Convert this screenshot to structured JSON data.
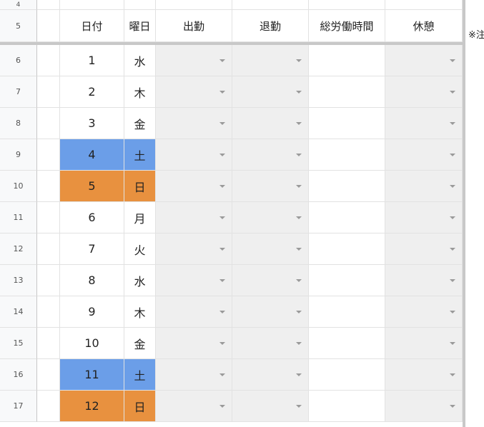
{
  "sheet": {
    "header_row_number": "5",
    "top_row_number": "4",
    "columns": {
      "date": "日付",
      "weekday": "曜日",
      "clock_in": "出勤",
      "clock_out": "退勤",
      "total_hours": "総労働時間",
      "break": "休憩"
    },
    "note_fragment": "※注",
    "rows": [
      {
        "row_number": "6",
        "date": "1",
        "weekday": "水",
        "highlight": "none"
      },
      {
        "row_number": "7",
        "date": "2",
        "weekday": "木",
        "highlight": "none"
      },
      {
        "row_number": "8",
        "date": "3",
        "weekday": "金",
        "highlight": "none"
      },
      {
        "row_number": "9",
        "date": "4",
        "weekday": "土",
        "highlight": "blue"
      },
      {
        "row_number": "10",
        "date": "5",
        "weekday": "日",
        "highlight": "orange"
      },
      {
        "row_number": "11",
        "date": "6",
        "weekday": "月",
        "highlight": "none"
      },
      {
        "row_number": "12",
        "date": "7",
        "weekday": "火",
        "highlight": "none"
      },
      {
        "row_number": "13",
        "date": "8",
        "weekday": "水",
        "highlight": "none"
      },
      {
        "row_number": "14",
        "date": "9",
        "weekday": "木",
        "highlight": "none"
      },
      {
        "row_number": "15",
        "date": "10",
        "weekday": "金",
        "highlight": "none"
      },
      {
        "row_number": "16",
        "date": "11",
        "weekday": "土",
        "highlight": "blue"
      },
      {
        "row_number": "17",
        "date": "12",
        "weekday": "日",
        "highlight": "orange"
      }
    ]
  },
  "colors": {
    "saturday": "#6b9ee8",
    "sunday": "#e8913f",
    "dropdown_cell": "#efefef",
    "grid_line": "#e2e2e2"
  },
  "icons": {
    "dropdown": "chevron-down-icon"
  }
}
